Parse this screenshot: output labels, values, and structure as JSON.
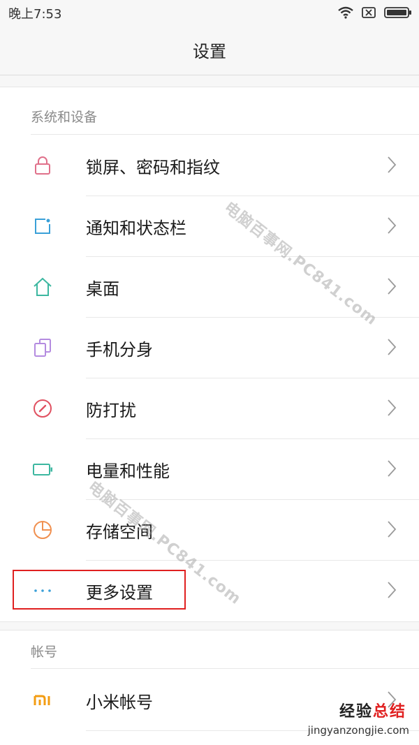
{
  "status_bar": {
    "time": "晚上7:53"
  },
  "header": {
    "title": "设置"
  },
  "sections": [
    {
      "title": "系统和设备",
      "items": [
        {
          "label": "锁屏、密码和指纹",
          "icon": "lock-icon",
          "color": "#e0708a"
        },
        {
          "label": "通知和状态栏",
          "icon": "notification-icon",
          "color": "#3aa0d8"
        },
        {
          "label": "桌面",
          "icon": "home-icon",
          "color": "#3cb7a0"
        },
        {
          "label": "手机分身",
          "icon": "dual-icon",
          "color": "#b48be0"
        },
        {
          "label": "防打扰",
          "icon": "dnd-icon",
          "color": "#e05060"
        },
        {
          "label": "电量和性能",
          "icon": "battery-icon",
          "color": "#3cb7a0"
        },
        {
          "label": "存储空间",
          "icon": "storage-icon",
          "color": "#f09050"
        },
        {
          "label": "更多设置",
          "icon": "more-icon",
          "color": "#3aa0d8"
        }
      ]
    },
    {
      "title": "帐号",
      "items": [
        {
          "label": "小米帐号",
          "icon": "mi-icon",
          "color": "#f39c12"
        }
      ]
    }
  ],
  "watermarks": {
    "text_1": "电脑百事网.PC841.com",
    "text_2": "电脑百事网.PC841.com"
  },
  "site_badge": {
    "brand_a": "经验",
    "brand_b": "总结",
    "url": "jingyanzongjie.com"
  }
}
